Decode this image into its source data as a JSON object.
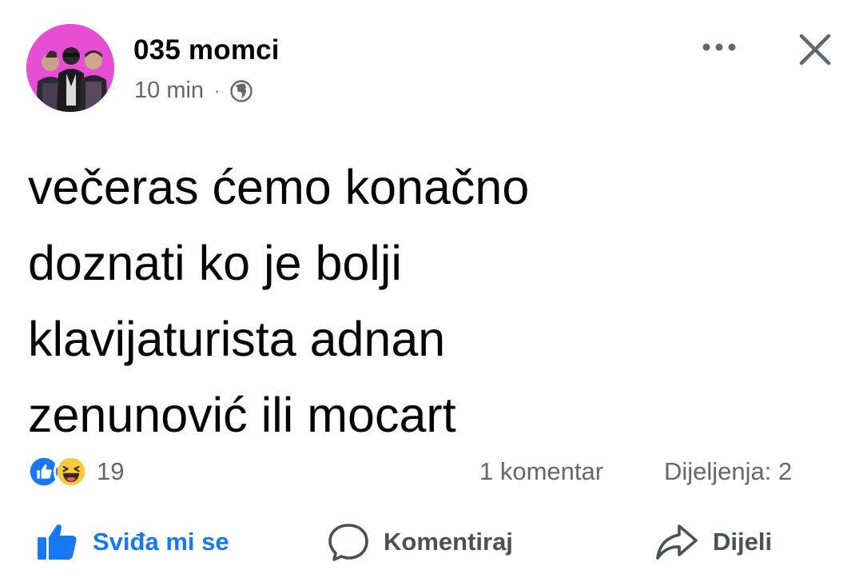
{
  "header": {
    "page_name": "035 momci",
    "time": "10 min",
    "separator": "·",
    "audience_icon": "globe-icon",
    "more_icon": "more-horizontal-icon",
    "close_icon": "close-icon"
  },
  "post": {
    "text": "večeras ćemo konačno\ndoznati ko je bolji\nklavijaturista adnan\nzenunović ili mocart"
  },
  "stats": {
    "reaction_icons": [
      "like-reaction-icon",
      "haha-reaction-icon"
    ],
    "reaction_count": "19",
    "comments": "1 komentar",
    "shares": "Dijeljenja: 2"
  },
  "actions": {
    "like": "Sviđa mi se",
    "comment": "Komentiraj",
    "share": "Dijeli"
  },
  "colors": {
    "accent": "#1877f2",
    "avatar_bg": "#e64fd3",
    "secondary_text": "#65676b",
    "haha_yellow": "#f7c940"
  }
}
